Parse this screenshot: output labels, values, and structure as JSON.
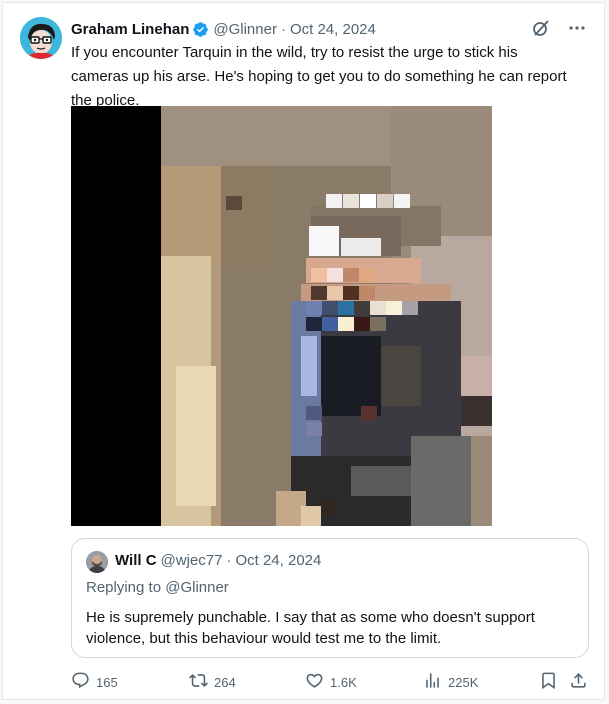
{
  "post": {
    "author_name": "Graham Linehan",
    "author_handle": "@Glinner",
    "separator": "·",
    "date": "Oct 24, 2024",
    "text": "If you encounter Tarquin in the wild, try to resist the urge to stick his cameras up his arse. He's hoping to get you to do something he can report the police."
  },
  "quoted": {
    "author_name": "Will C",
    "author_handle": "@wjec77",
    "separator": "·",
    "date": "Oct 24, 2024",
    "replying_prefix": "Replying to ",
    "replying_handle": "@Glinner",
    "text": "He is supremely punchable. I say that as some who doesn't support violence, but this behaviour would test me to the limit."
  },
  "actions": {
    "replies": "165",
    "reposts": "264",
    "likes": "1.6K",
    "views": "225K"
  },
  "icons": [
    "verified-badge-icon",
    "grok-icon",
    "more-icon",
    "reply-icon",
    "repost-icon",
    "like-icon",
    "views-icon",
    "bookmark-icon",
    "share-icon"
  ],
  "colors": {
    "verified": "#1d9bf0",
    "secondary_text": "#536471",
    "primary_text": "#0f1419"
  }
}
